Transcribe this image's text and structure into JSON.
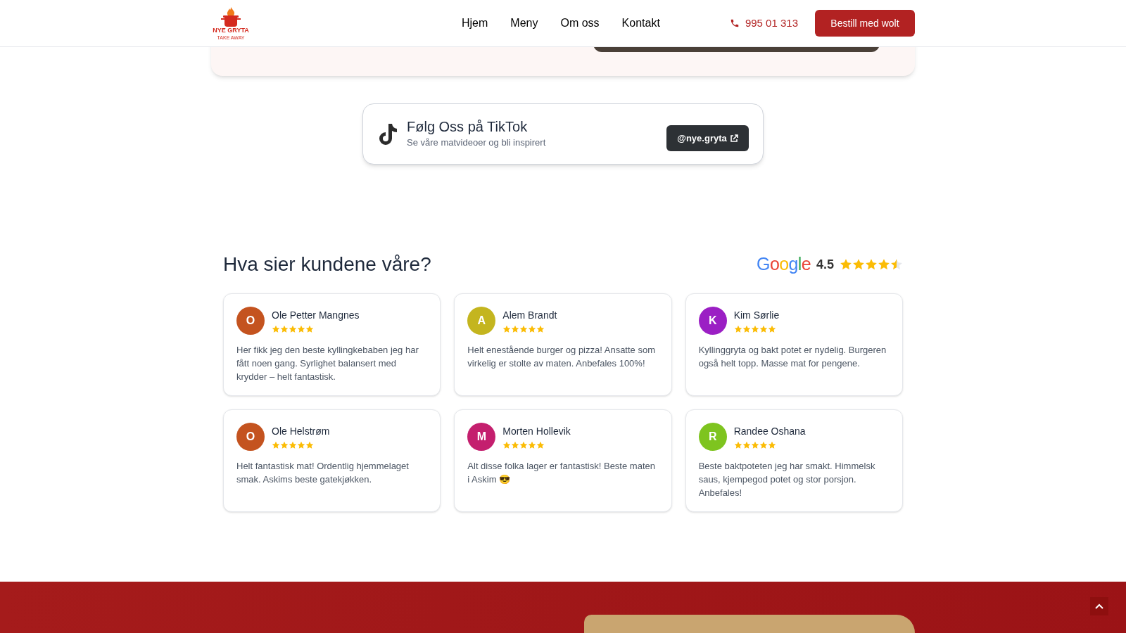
{
  "header": {
    "logo": {
      "name": "NYE GRYTA",
      "tagline": "TAKE AWAY"
    },
    "nav": [
      {
        "label": "Hjem"
      },
      {
        "label": "Meny"
      },
      {
        "label": "Om oss"
      },
      {
        "label": "Kontakt"
      }
    ],
    "phone": "995 01 313",
    "order_button": "Bestill med wolt"
  },
  "tiktok": {
    "title": "Følg Oss på TikTok",
    "subtitle": "Se våre matvideoer og bli inspirert",
    "button": "@nye.gryta"
  },
  "reviews": {
    "heading": "Hva sier kundene våre?",
    "google": {
      "brand": "Google",
      "rating": "4.5",
      "stars": 4.5
    },
    "items": [
      {
        "initial": "O",
        "color": "#c4531f",
        "name": "Ole Petter Mangnes",
        "stars": 5,
        "text": "Her fikk jeg den beste kyllingkebaben jeg har fått noen gang. Syrlighet balansert med krydder – helt fantastisk."
      },
      {
        "initial": "A",
        "color": "#c4b51f",
        "name": "Alem Brandt",
        "stars": 5,
        "text": "Helt enestående burger og pizza! Ansatte som virkelig er stolte av maten. Anbefales 100%!"
      },
      {
        "initial": "K",
        "color": "#9b1fc4",
        "name": "Kim Sørlie",
        "stars": 5,
        "text": "Kyllinggryta og bakt potet er nydelig. Burgeren også helt topp. Masse mat for pengene."
      },
      {
        "initial": "O",
        "color": "#c4531f",
        "name": "Ole Helstrøm",
        "stars": 5,
        "text": "Helt fantastisk mat! Ordentlig hjemmelaget smak. Askims beste gatekjøkken."
      },
      {
        "initial": "M",
        "color": "#c41f6e",
        "name": "Morten Hollevik",
        "stars": 5,
        "text": "Alt disse folka lager er fantastisk! Beste maten i Askim 😎"
      },
      {
        "initial": "R",
        "color": "#7ec41f",
        "name": "Randee Oshana",
        "stars": 5,
        "text": "Beste baktpoteten jeg har smakt. Himmelsk saus, kjempegod potet og stor porsjon. Anbefales!"
      }
    ]
  }
}
